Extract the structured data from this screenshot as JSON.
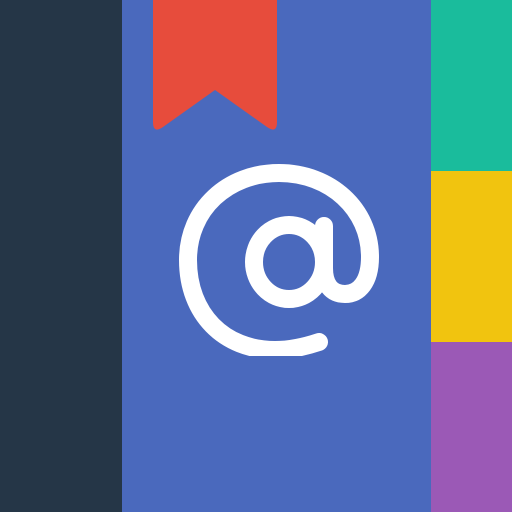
{
  "icon": {
    "name": "contacts-app-icon",
    "glyph": "@",
    "colors": {
      "spine": "#253647",
      "cover": "#4a69bd",
      "bookmark": "#e74c3c",
      "glyph": "#ffffff",
      "tab_green": "#1abc9c",
      "tab_yellow": "#f1c40f",
      "tab_purple": "#9b59b6"
    }
  }
}
